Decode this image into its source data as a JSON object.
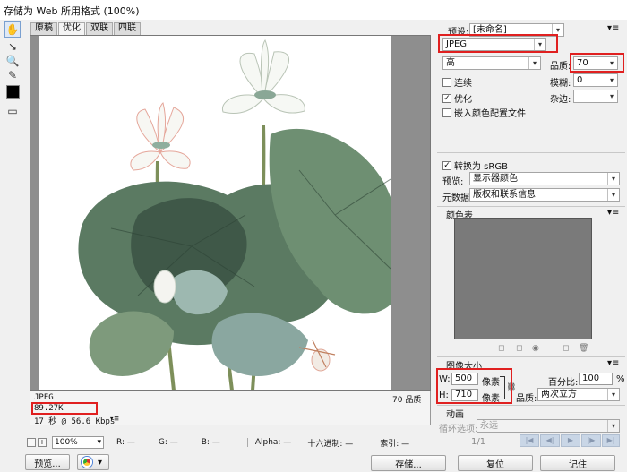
{
  "window": {
    "title": "存储为 Web 所用格式 (100%)"
  },
  "view_tabs": [
    "原稿",
    "优化",
    "双联",
    "四联"
  ],
  "image_info": {
    "format": "JPEG",
    "file_size": "89.27K",
    "download_time": "17 秒 @ 56.6 Kbps",
    "quality_label": "70 品质"
  },
  "status_bar": {
    "zoom": "100%",
    "r": "R: —",
    "g": "G: —",
    "b": "B: —",
    "alpha": "Alpha: —",
    "hex": "十六进制: —",
    "index": "索引: —"
  },
  "buttons": {
    "preview": "预览...",
    "save": "存储...",
    "reset": "复位",
    "remember": "记住"
  },
  "settings": {
    "preset_label": "预设:",
    "preset_value": "[未命名]",
    "format": "JPEG",
    "quality_level": "高",
    "quality_label": "品质:",
    "quality_value": "70",
    "progressive_label": "连续",
    "blur_label": "模糊:",
    "blur_value": "0",
    "optimized_label": "优化",
    "matte_label": "杂边:",
    "matte_value": "",
    "embed_profile_label": "嵌入颜色配置文件",
    "convert_srgb_label": "转换为 sRGB",
    "preview_label": "预览:",
    "preview_value": "显示器颜色",
    "metadata_label": "元数据:",
    "metadata_value": "版权和联系信息"
  },
  "color_table": {
    "title": "颜色表"
  },
  "image_size": {
    "title": "图像大小",
    "w_label": "W:",
    "w_value": "500",
    "h_label": "H:",
    "h_value": "710",
    "unit": "像素",
    "percent_label": "百分比:",
    "percent_value": "100",
    "percent_unit": "%",
    "quality_label": "品质:",
    "quality_value": "两次立方"
  },
  "animation": {
    "title": "动画",
    "loop_label": "循环选项:",
    "loop_value": "永远",
    "frame_counter": "1/1"
  },
  "colors": {
    "highlight": "#e02020",
    "color_table_bg": "#7a7a7a",
    "button_blue": "#c9d6e6"
  }
}
